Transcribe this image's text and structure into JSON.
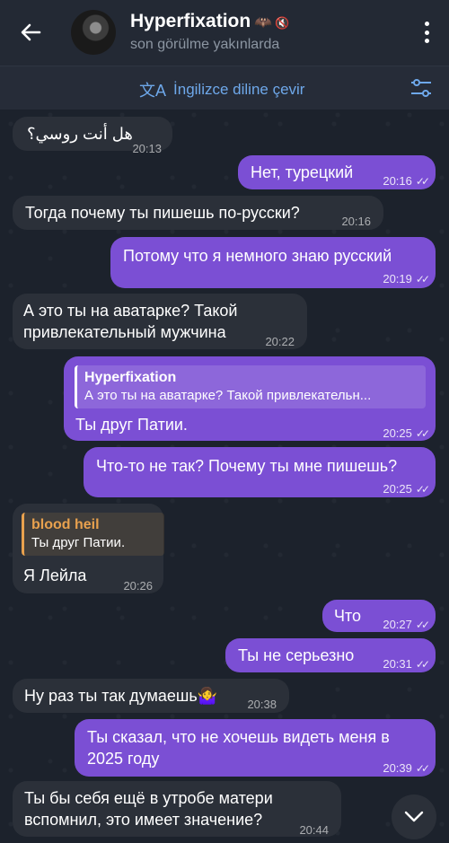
{
  "header": {
    "name": "Hyperfixation",
    "name_emoji": "🦇",
    "status": "son görülme yakınlarda"
  },
  "translate_bar": {
    "label": "İngilizce diline çevir"
  },
  "messages": [
    {
      "dir": "in",
      "text": "هل أنت روسي؟",
      "time": "20:13"
    },
    {
      "dir": "out",
      "text": "Нет, турецкий",
      "time": "20:16"
    },
    {
      "dir": "in",
      "text": "Тогда почему ты пишешь по-русски?",
      "time": "20:16"
    },
    {
      "dir": "out",
      "text": "Потому что я немного знаю русский",
      "time": "20:19"
    },
    {
      "dir": "in",
      "text": "А это ты на аватарке? Такой привлекательный мужчина",
      "time": "20:22"
    },
    {
      "dir": "out",
      "reply_name": "Hyperfixation",
      "reply_text": "А это ты на аватарке? Такой привлекательн...",
      "text": "Ты друг Патии.",
      "time": "20:25"
    },
    {
      "dir": "out",
      "text": "Что-то не так? Почему ты мне пишешь?",
      "time": "20:25"
    },
    {
      "dir": "in",
      "reply_name": "blood heil",
      "reply_text": "Ты друг Патии.",
      "text": "Я Лейла",
      "time": "20:26"
    },
    {
      "dir": "out",
      "text": "Что",
      "time": "20:27"
    },
    {
      "dir": "out",
      "text": "Ты не серьезно",
      "time": "20:31"
    },
    {
      "dir": "in",
      "text": "Ну раз ты так думаешь🤷‍♀️",
      "time": "20:38"
    },
    {
      "dir": "out",
      "text": "Ты сказал, что не хочешь видеть меня в 2025 году",
      "time": "20:39"
    },
    {
      "dir": "in",
      "text": "Ты бы себя ещё в утробе матери вспомнил, это имеет значение?",
      "time": "20:44"
    }
  ],
  "icons": {
    "back": "back-arrow-icon",
    "menu": "kebab-menu-icon",
    "translate": "translate-icon",
    "filter": "settings-sliders-icon",
    "scroll": "chevron-down-icon"
  },
  "colors": {
    "outgoing_bubble": "#7b4fd4",
    "incoming_bubble": "#2b3039",
    "accent_link": "#6ea8ea",
    "reply_accent_out": "#ffffff",
    "reply_accent_in": "#e8a14e"
  }
}
